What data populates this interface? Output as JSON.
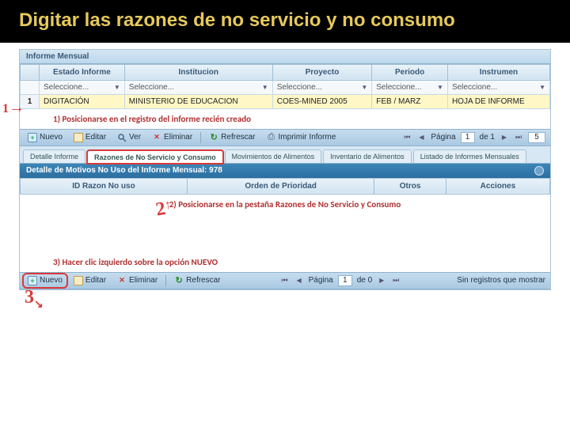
{
  "slide": {
    "title": "Digitar las razones de no servicio y no consumo"
  },
  "panel1": {
    "title": "Informe Mensual",
    "cols": [
      "",
      "Estado Informe",
      "Institucion",
      "Proyecto",
      "Periodo",
      "Instrumen"
    ],
    "filter_placeholder": "Seleccione...",
    "row": {
      "id": "1",
      "estado": "DIGITACIÓN",
      "inst": "MINISTERIO DE EDUCACION",
      "proyecto": "COES-MINED 2005",
      "periodo": "FEB / MARZ",
      "instr": "HOJA DE INFORME"
    }
  },
  "annotations": {
    "a1": "1) Posicionarse en el registro del informe recién creado",
    "a2": "2) Posicionarse en la pestaña Razones de No Servicio y Consumo",
    "a3": "3) Hacer clic izquierdo sobre la opción NUEVO"
  },
  "toolbar1": {
    "nuevo": "Nuevo",
    "editar": "Editar",
    "ver": "Ver",
    "eliminar": "Eliminar",
    "refrescar": "Refrescar",
    "imprimir": "Imprimir Informe",
    "pagina_lbl": "Página",
    "pagina_val": "1",
    "de": "de 1",
    "per_page": "5"
  },
  "tabs": {
    "t1": "Detalle Informe",
    "t2": "Razones de No Servicio y Consumo",
    "t3": "Movimientos de Alimentos",
    "t4": "Inventario de Alimentos",
    "t5": "Listado de Informes Mensuales"
  },
  "panel2": {
    "title": "Detalle de Motivos No Uso del Informe Mensual: 978",
    "cols": [
      "ID Razon No uso",
      "Orden de Prioridad",
      "Otros",
      "Acciones"
    ]
  },
  "toolbar2": {
    "nuevo": "Nuevo",
    "editar": "Editar",
    "eliminar": "Eliminar",
    "refrescar": "Refrescar",
    "pagina_lbl": "Página",
    "pagina_val": "1",
    "de": "de 0",
    "norecords": "Sin registros que mostrar"
  }
}
